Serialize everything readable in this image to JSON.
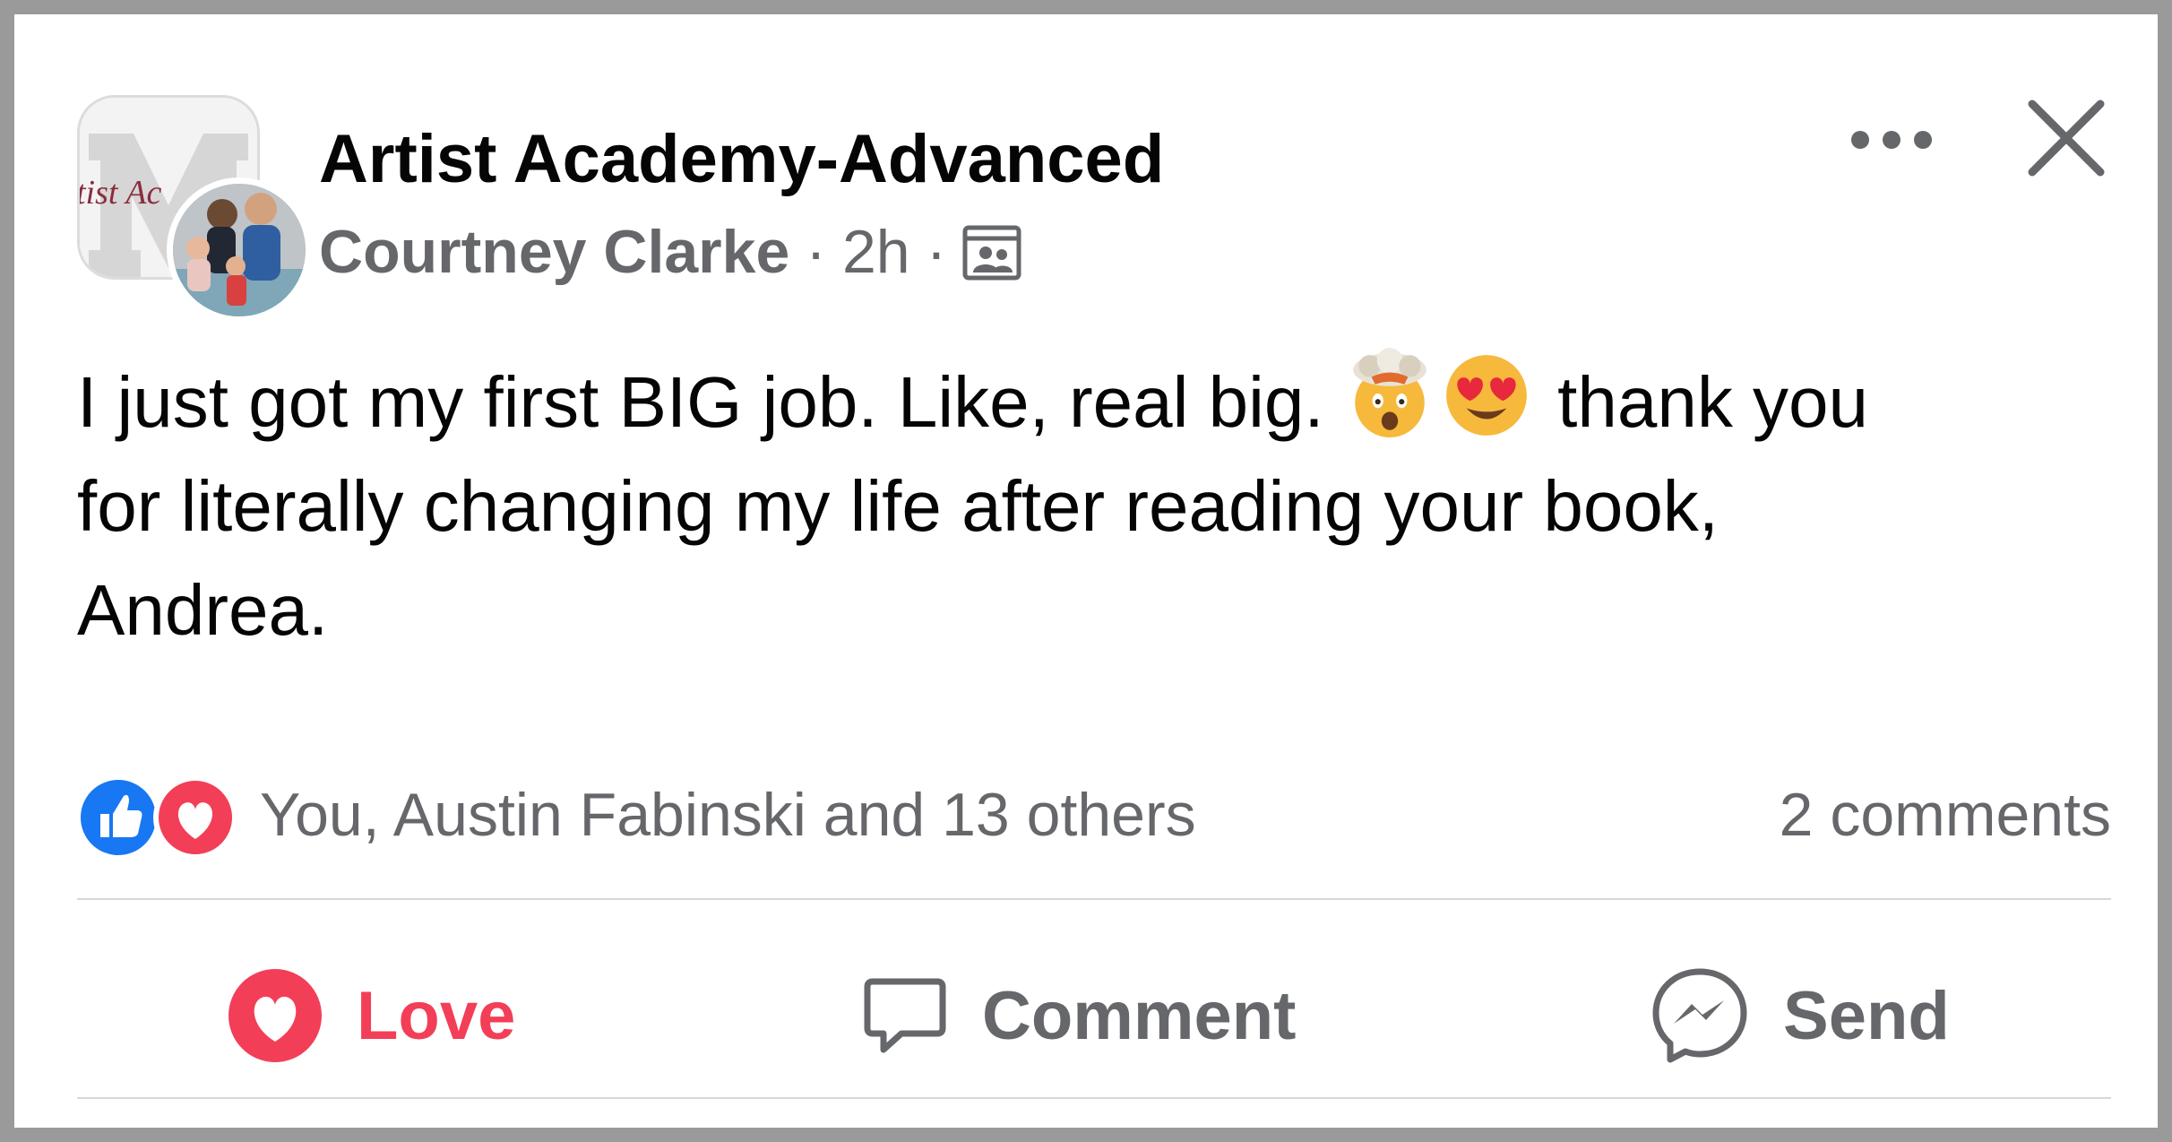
{
  "post": {
    "group_name": "Artist Academy-Advanced",
    "group_avatar_text": "tist Ac",
    "author": "Courtney Clarke",
    "time": "2h",
    "separator": "·",
    "text_line1_a": "I just got my first BIG job. Like, real big.",
    "text_line1_b": "thank you",
    "text_line2": "for literally changing my life after reading your book,",
    "text_line3": "Andrea.",
    "emojis": [
      "exploding-head-emoji",
      "heart-eyes-emoji"
    ]
  },
  "reactions": {
    "icons": [
      "like-icon",
      "love-icon"
    ],
    "summary": "You, Austin Fabinski and 13 others",
    "comments": "2 comments"
  },
  "actions": {
    "love_label": "Love",
    "comment_label": "Comment",
    "send_label": "Send"
  },
  "colors": {
    "love": "#f33e58",
    "like": "#1877f2",
    "secondary_text": "#65676b",
    "primary_text": "#050505"
  }
}
